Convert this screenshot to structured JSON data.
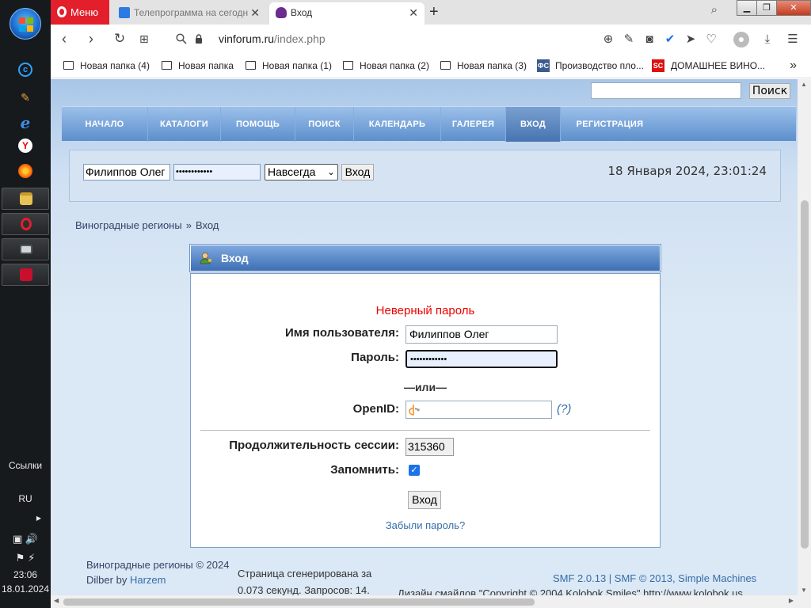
{
  "taskbar": {
    "links_label": "Ссылки",
    "language": "RU",
    "time": "23:06",
    "date": "18.01.2024"
  },
  "browser": {
    "menu_label": "Меню",
    "tabs": [
      {
        "title": "Телепрограмма на сегодн",
        "active": false
      },
      {
        "title": "Вход",
        "active": true
      }
    ],
    "url_host": "vinforum.ru",
    "url_path": "/index.php",
    "bookmarks": [
      {
        "label": "Новая папка (4)",
        "type": "folder"
      },
      {
        "label": "Новая папка",
        "type": "folder"
      },
      {
        "label": "Новая папка (1)",
        "type": "folder"
      },
      {
        "label": "Новая папка (2)",
        "type": "folder"
      },
      {
        "label": "Новая папка (3)",
        "type": "folder"
      },
      {
        "label": "Производство пло...",
        "type": "site"
      },
      {
        "label": "ДОМАШНЕЕ ВИНО...",
        "type": "site",
        "badge": "SC"
      }
    ]
  },
  "site": {
    "search_button": "Поиск",
    "nav": [
      {
        "label": "НАЧАЛО",
        "active": false
      },
      {
        "label": "КАТАЛОГИ",
        "active": false
      },
      {
        "label": "ПОМОЩЬ",
        "active": false
      },
      {
        "label": "ПОИСК",
        "active": false
      },
      {
        "label": "КАЛЕНДАРЬ",
        "active": false
      },
      {
        "label": "ГАЛЕРЕЯ",
        "active": false
      },
      {
        "label": "ВХОД",
        "active": true
      },
      {
        "label": "РЕГИСТРАЦИЯ",
        "active": false
      }
    ],
    "userbar": {
      "username_value": "Филиппов Олег",
      "password_mask": "••••••••••••",
      "duration_selected": "Навсегда",
      "login_button": "Вход",
      "datetime": "18 Января 2024, 23:01:24"
    },
    "breadcrumb": {
      "items": [
        "Виноградные регионы",
        "Вход"
      ],
      "separator": "»"
    },
    "login": {
      "title": "Вход",
      "error": "Неверный пароль",
      "username_label": "Имя пользователя:",
      "username_value": "Филиппов Олег",
      "password_label": "Пароль:",
      "password_mask": "••••••••••••",
      "or_text": "—или—",
      "openid_label": "OpenID:",
      "openid_help": "(?)",
      "session_label": "Продолжительность сессии:",
      "session_value": "315360",
      "remember_label": "Запомнить:",
      "remember_checked": true,
      "submit": "Вход",
      "forgot": "Забыли пароль?"
    },
    "footer": {
      "copyright": "Виноградные регионы © 2024",
      "theme_prefix": "Dilber",
      "theme_by": "by",
      "theme_author": "Harzem",
      "generated_line1": "Страница сгенерирована за",
      "generated_line2": "0.073 секунд. Запросов: 14.",
      "smf": "SMF 2.0.13 | SMF © 2013, Simple Machines",
      "smiles": "Дизайн смайлов \"Copyright © 2004 Kolobok Smiles\" http://www.kolobok.us"
    }
  },
  "colors": {
    "error": "#e00000",
    "nav_gradient_top": "#9cc0ea",
    "nav_gradient_bottom": "#5d8fcd",
    "link": "#346da8",
    "opera_red": "#e21f2a"
  }
}
